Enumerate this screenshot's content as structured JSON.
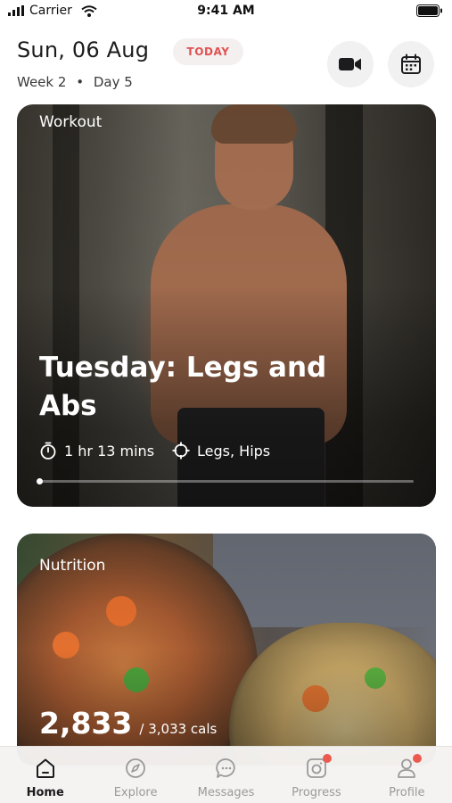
{
  "status_bar": {
    "carrier": "Carrier",
    "time": "9:41 AM"
  },
  "header": {
    "date": "Sun, 06 Aug",
    "today_label": "TODAY",
    "week": "Week 2",
    "separator": "•",
    "day": "Day 5",
    "icons": [
      "video-camera-icon",
      "calendar-icon"
    ]
  },
  "workout_card": {
    "label": "Workout",
    "title": "Tuesday: Legs and Abs",
    "duration": "1 hr 13 mins",
    "focus": "Legs, Hips",
    "progress": 0.0
  },
  "nutrition_card": {
    "label": "Nutrition",
    "calories_consumed": "2,833",
    "calories_total": "/ 3,033 cals"
  },
  "tab_bar": {
    "tabs": [
      {
        "label": "Home",
        "icon": "home-icon",
        "active": true,
        "badge": false
      },
      {
        "label": "Explore",
        "icon": "compass-icon",
        "active": false,
        "badge": false
      },
      {
        "label": "Messages",
        "icon": "chat-bubble-icon",
        "active": false,
        "badge": false
      },
      {
        "label": "Progress",
        "icon": "camera-icon",
        "active": false,
        "badge": true
      },
      {
        "label": "Profile",
        "icon": "person-icon",
        "active": false,
        "badge": true
      }
    ]
  },
  "colors": {
    "accent_red": "#e05252",
    "badge_red": "#ec5a4f",
    "pill_bg": "#f3f0ef"
  }
}
